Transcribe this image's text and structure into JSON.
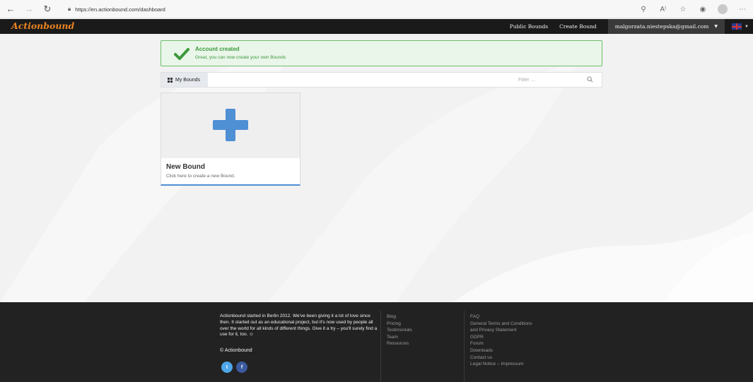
{
  "browser": {
    "url": "https://en.actionbound.com/dashboard"
  },
  "nav": {
    "brand": "Actionbound",
    "public_bounds": "Public Bounds",
    "create_bound": "Create Bound",
    "user_email": "malgorzata.niestepska@gmail.com"
  },
  "alert": {
    "title": "Account created",
    "text": "Great, you can now create your own Bounds"
  },
  "toolbar": {
    "my_bounds_label": "My Bounds",
    "filter_placeholder": "Filter ..."
  },
  "card": {
    "title": "New Bound",
    "text": "Click here to create a new Bound."
  },
  "footer": {
    "about": "Actionbound started in Berlin 2012. We've been giving it a lot of love since then. It started out as an educational project, but it's now used by people all over the world for all kinds of different things. Give it a try – you'll surely find a use for it, too. ☺",
    "copyright": "© Actionbound",
    "twitter_glyph": "t",
    "facebook_glyph": "f",
    "col1": [
      "Blog",
      "Pricing",
      "Testimonials",
      "Team",
      "Resources"
    ],
    "col2": [
      "FAQ",
      "General Terms and Conditions",
      "and Privacy Statement",
      "GDPR",
      "Forum",
      "Downloads",
      "Contact us",
      "Legal Notice – Impressum"
    ]
  },
  "colors": {
    "brand_orange": "#e98423",
    "accent_blue": "#4f8fd4",
    "success_green": "#3c9a3c",
    "nav_dark": "#1a1a1a",
    "footer_dark": "#222222"
  }
}
